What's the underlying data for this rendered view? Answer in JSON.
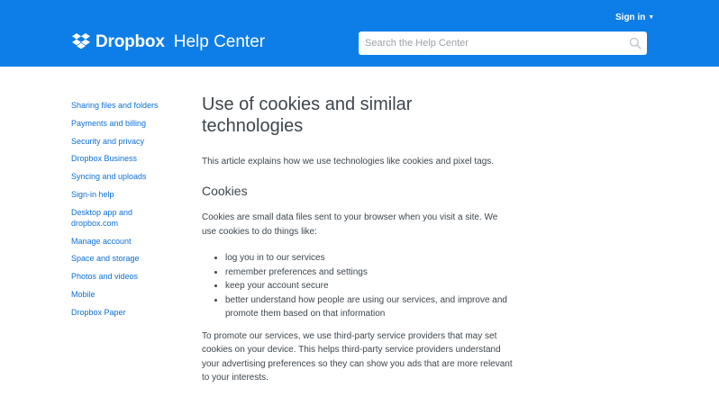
{
  "header": {
    "brand": "Dropbox",
    "brand_sub": "Help Center",
    "signin_label": "Sign in",
    "search_placeholder": "Search the Help Center",
    "colors": {
      "header_bg": "#0d7ee7",
      "link": "#0d6fd6"
    },
    "icons": [
      "dropbox-logo-icon",
      "chevron-down-icon",
      "search-icon"
    ]
  },
  "sidebar": {
    "items": [
      {
        "label": "Sharing files and folders"
      },
      {
        "label": "Payments and billing"
      },
      {
        "label": "Security and privacy"
      },
      {
        "label": "Dropbox Business"
      },
      {
        "label": "Syncing and uploads"
      },
      {
        "label": "Sign-in help"
      },
      {
        "label": "Desktop app and dropbox.com"
      },
      {
        "label": "Manage account"
      },
      {
        "label": "Space and storage"
      },
      {
        "label": "Photos and videos"
      },
      {
        "label": "Mobile"
      },
      {
        "label": "Dropbox Paper"
      }
    ]
  },
  "article": {
    "title": "Use of cookies and similar technologies",
    "intro": "This article explains how we use technologies like cookies and pixel tags.",
    "section_heading": "Cookies",
    "paragraph1": "Cookies are small data files sent to your browser when you visit a site. We use cookies to do things like:",
    "bullets": [
      "log you in to our services",
      "remember preferences and settings",
      "keep your account secure",
      "better understand how people are using our services, and improve and promote them based on that information"
    ],
    "paragraph2": "To promote our services, we use third-party service providers that may set cookies on your device. This helps third-party service providers understand your advertising preferences so they can show you ads that are more relevant to your interests."
  }
}
